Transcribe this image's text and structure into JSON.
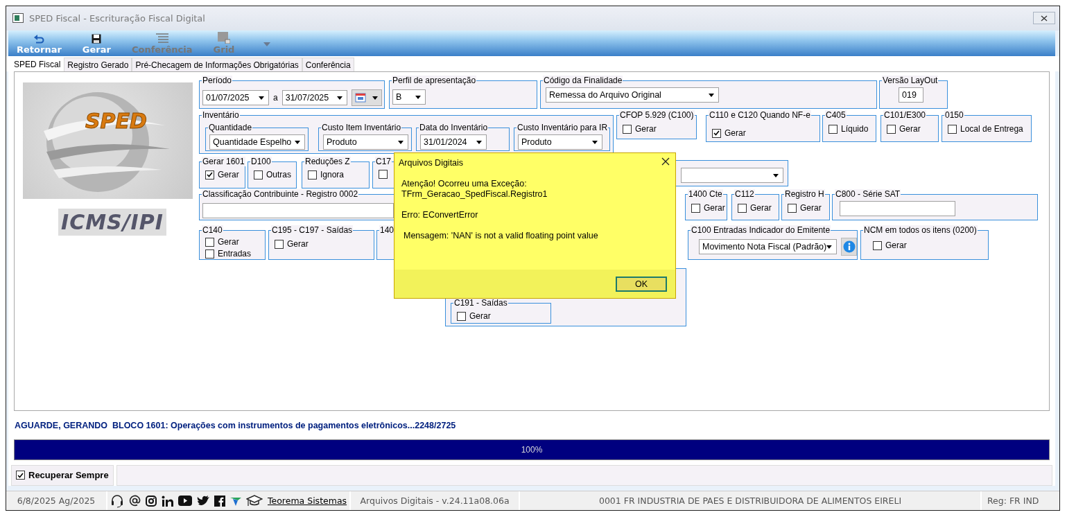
{
  "window": {
    "title": "SPED Fiscal - Escrituração Fiscal Digital"
  },
  "toolbar": [
    {
      "label": "Retornar",
      "kind": "undo",
      "disabled": false
    },
    {
      "label": "Gerar",
      "kind": "save",
      "disabled": false
    },
    {
      "label": "Conferência",
      "kind": "list",
      "disabled": true
    },
    {
      "label": "Grid",
      "kind": "grid",
      "disabled": true
    }
  ],
  "tabs": [
    {
      "label": "SPED Fiscal",
      "selected": true
    },
    {
      "label": "Registro Gerado",
      "selected": false
    },
    {
      "label": "Pré-Checagem de Informações Obrigatórias",
      "selected": false
    },
    {
      "label": "Conferência",
      "selected": false
    }
  ],
  "logo": {
    "mark": "SPED",
    "caption": "ICMS/IPI"
  },
  "form": {
    "lines": [
      {
        "groups": [
          {
            "label": "Período",
            "controls": [
              {
                "kind": "date",
                "value": "01/07/2025"
              },
              {
                "kind": "text",
                "text": "a"
              },
              {
                "kind": "date",
                "value": "31/07/2025"
              },
              {
                "kind": "calendar"
              }
            ]
          },
          {
            "label": "Perfil de apresentação",
            "controls": [
              {
                "kind": "combo",
                "value": "B"
              }
            ]
          },
          {
            "label": "Código da Finalidade",
            "controls": [
              {
                "kind": "combo",
                "value": "Remessa do Arquivo Original"
              }
            ]
          },
          {
            "label": "Versão LayOut",
            "controls": [
              {
                "kind": "input",
                "value": "019"
              }
            ]
          }
        ]
      },
      {
        "groups": [
          {
            "label": "Inventário",
            "controls": [
              {
                "kind": "group",
                "label": "Quantidade",
                "controls": [
                  {
                    "kind": "combo",
                    "value": "Quantidade Espelho"
                  }
                ]
              },
              {
                "kind": "group",
                "label": "Custo Item Inventário",
                "controls": [
                  {
                    "kind": "combo",
                    "value": "Produto"
                  }
                ]
              },
              {
                "kind": "group",
                "label": "Data do Inventário",
                "controls": [
                  {
                    "kind": "combo",
                    "value": "31/01/2024"
                  }
                ]
              },
              {
                "kind": "group",
                "label": "Custo Inventário para IR",
                "controls": [
                  {
                    "kind": "combo",
                    "value": "Produto"
                  }
                ]
              }
            ]
          },
          {
            "label": "CFOP 5.929 (C100)",
            "controls": [
              {
                "kind": "check",
                "label": "Gerar",
                "checked": false
              }
            ]
          },
          {
            "label": "C110 e C120 Quando NF-e",
            "controls": [
              {
                "kind": "check",
                "label": "Gerar",
                "checked": true
              }
            ]
          },
          {
            "label": "C405",
            "controls": [
              {
                "kind": "check",
                "label": "Líquido",
                "checked": false
              }
            ]
          },
          {
            "label": "C101/E300",
            "controls": [
              {
                "kind": "check",
                "label": "Gerar",
                "checked": false
              }
            ]
          },
          {
            "label": "0150",
            "controls": [
              {
                "kind": "check",
                "label": "Local de Entrega",
                "checked": false
              }
            ]
          }
        ]
      },
      {
        "groups": [
          {
            "label": "Gerar 1601",
            "controls": [
              {
                "kind": "check",
                "label": "Gerar",
                "checked": true
              }
            ]
          },
          {
            "label": "D100",
            "controls": [
              {
                "kind": "check",
                "label": "Outras",
                "checked": false
              }
            ]
          },
          {
            "label": "Reduções Z",
            "controls": [
              {
                "kind": "check",
                "label": "Ignora",
                "checked": false
              }
            ]
          },
          {
            "label": "C17",
            "controls": [
              {
                "kind": "check",
                "checked": false
              }
            ]
          },
          {
            "controls": [
              {
                "kind": "combo"
              }
            ]
          }
        ]
      },
      {
        "groups": [
          {
            "label": "Classificação Contribuinte - Registro 0002",
            "controls": [
              {
                "kind": "input"
              }
            ]
          },
          {
            "label": "1400 Cte",
            "controls": [
              {
                "kind": "check",
                "label": "Gerar",
                "checked": false
              }
            ]
          },
          {
            "label": "C112",
            "controls": [
              {
                "kind": "check",
                "label": "Gerar",
                "checked": false
              }
            ]
          },
          {
            "label": "Registro H",
            "controls": [
              {
                "kind": "check",
                "label": "Gerar",
                "checked": false
              }
            ]
          },
          {
            "label": "C800 - Série SAT",
            "controls": [
              {
                "kind": "input"
              }
            ]
          }
        ]
      },
      {
        "groups": [
          {
            "label": "C140",
            "controls": [
              {
                "kind": "check",
                "label": "Gerar",
                "checked": false
              },
              {
                "kind": "check",
                "label": "Entradas",
                "checked": false
              }
            ]
          },
          {
            "label": "C195 - C197 - Saídas",
            "controls": [
              {
                "kind": "check",
                "label": "Gerar",
                "checked": false
              }
            ]
          },
          {
            "label": "140"
          },
          {
            "label": "C100 Entradas Indicador do Emitente",
            "controls": [
              {
                "kind": "combo",
                "value": "Movimento Nota Fiscal (Padrão)"
              },
              {
                "kind": "info"
              }
            ]
          },
          {
            "label": "NCM em todos os itens (0200)",
            "controls": [
              {
                "kind": "check",
                "label": "Gerar",
                "checked": false
              }
            ]
          }
        ]
      },
      {
        "groups": [
          {
            "controls": [
              {
                "kind": "group",
                "label": "C191 - Saídas",
                "controls": [
                  {
                    "kind": "check",
                    "label": "Gerar",
                    "checked": false
                  }
                ]
              }
            ]
          }
        ]
      }
    ]
  },
  "status_message": "AGUARDE, GERANDO  BLOCO 1601: Operações com instrumentos de pagamentos eletrônicos...2248/2725",
  "progress": {
    "level": 1,
    "reading": "100%"
  },
  "bottom_bar": {
    "check": {
      "label": "Recuperar Sempre",
      "checked": true
    }
  },
  "status_bar": {
    "date": "6/8/2025 Ag/2025",
    "link": "Teorema Sistemas",
    "version": "Arquivos Digitais - v.24.11a08.06a",
    "company": "0001 FR INDUSTRIA DE PAES E DISTRIBUIDORA DE ALIMENTOS EIRELI",
    "region": "Reg: FR IND"
  },
  "dialog": {
    "title": "Arquivos Digitais",
    "lines": [
      "Atenção! Ocorreu uma Exceção:",
      "TFrm_Geracao_SpedFiscal.Registro1",
      "Erro: EConvertError",
      "Mensagem: 'NAN' is not a valid floating point value"
    ],
    "button": "OK"
  }
}
